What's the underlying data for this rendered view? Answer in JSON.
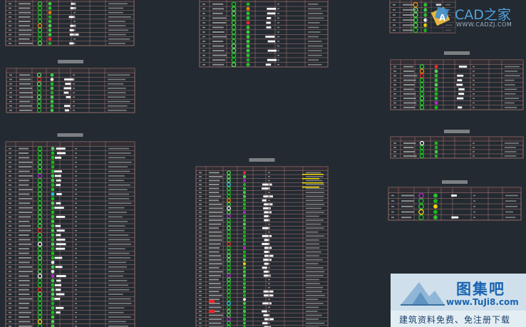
{
  "drawing": {
    "background": "#232a31",
    "grid_line_color": "#b07a78",
    "text_line_color": "#8f8f8f",
    "title_color": "#c7c7c7",
    "tables": [
      {
        "id": "table-top-left",
        "title": "",
        "rows": 10
      },
      {
        "id": "table-top-center",
        "title": "",
        "rows": 14
      },
      {
        "id": "table-top-right",
        "title": "",
        "rows": 6
      },
      {
        "id": "table-middle-left",
        "title": "",
        "rows": 9
      },
      {
        "id": "table-right-2",
        "title": "",
        "rows": 10
      },
      {
        "id": "table-right-3",
        "title": "",
        "rows": 4
      },
      {
        "id": "table-right-4",
        "title": "",
        "rows": 5
      },
      {
        "id": "table-bottom-left",
        "title": "",
        "rows": 40
      },
      {
        "id": "table-bottom-center",
        "title": "",
        "rows": 40
      }
    ]
  },
  "watermarks": {
    "cad": {
      "name": "CAD之家",
      "url": "WWW.CADZJ.COM",
      "color": "#4fa3e0"
    },
    "tuji": {
      "name": "图集吧",
      "url": "www.TuJi8.com",
      "slogan": "建筑资料免费、免注册下载",
      "color": "#1a64b0"
    }
  }
}
